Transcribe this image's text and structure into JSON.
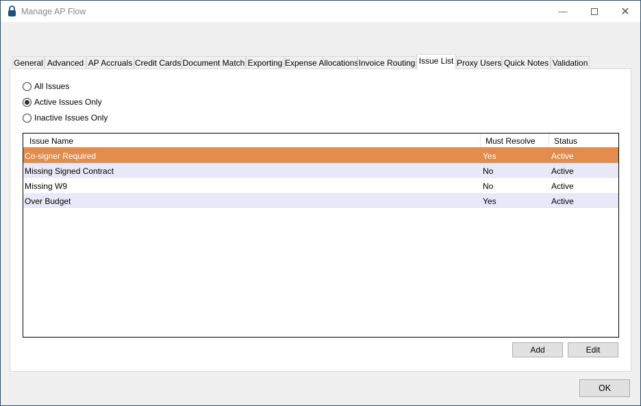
{
  "window": {
    "title": "Manage AP Flow",
    "icon": "lock-icon"
  },
  "tabs": [
    {
      "label": "General"
    },
    {
      "label": "Advanced"
    },
    {
      "label": "AP Accruals"
    },
    {
      "label": "Credit Cards"
    },
    {
      "label": "Document Match"
    },
    {
      "label": "Exporting"
    },
    {
      "label": "Expense Allocations"
    },
    {
      "label": "Invoice Routing"
    },
    {
      "label": "Issue List",
      "active": true
    },
    {
      "label": "Proxy Users"
    },
    {
      "label": "Quick Notes"
    },
    {
      "label": "Validation"
    }
  ],
  "filters": [
    {
      "label": "All Issues",
      "checked": false
    },
    {
      "label": "Active Issues Only",
      "checked": true
    },
    {
      "label": "Inactive Issues Only",
      "checked": false
    }
  ],
  "table": {
    "columns": [
      "Issue Name",
      "Must Resolve",
      "Status"
    ],
    "rows": [
      [
        "Co-signer Required",
        "Yes",
        "Active"
      ],
      [
        "Missing Signed Contract",
        "No",
        "Active"
      ],
      [
        "Missing W9",
        "No",
        "Active"
      ],
      [
        "Over Budget",
        "Yes",
        "Active"
      ]
    ],
    "selected_row": 0
  },
  "colors": {
    "selected": "#e28c4d",
    "alt_row": "#e8e8f8"
  },
  "buttons": {
    "add": "Add",
    "edit": "Edit",
    "ok": "OK"
  }
}
